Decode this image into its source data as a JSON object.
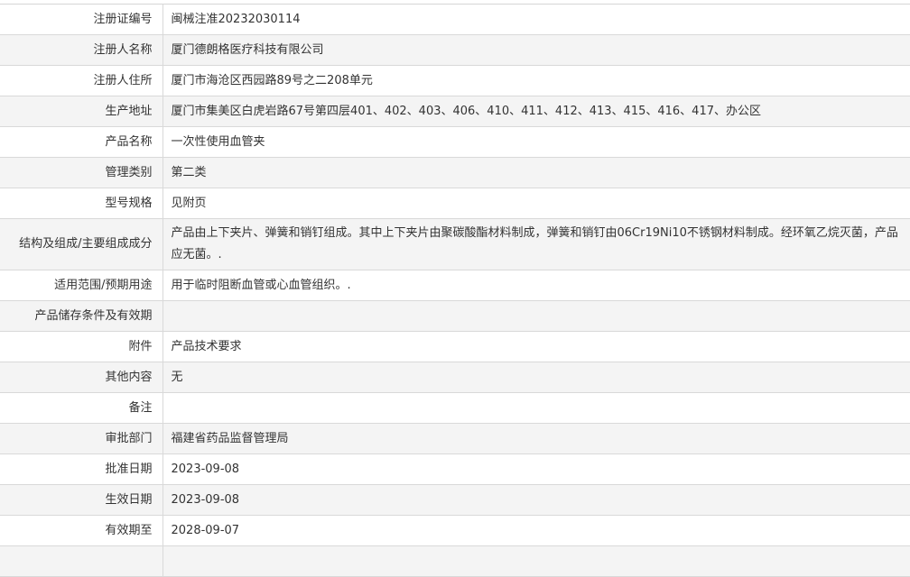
{
  "record": {
    "rows": [
      {
        "label": "注册证编号",
        "value": "闽械注准20232030114"
      },
      {
        "label": "注册人名称",
        "value": "厦门德朗格医疗科技有限公司"
      },
      {
        "label": "注册人住所",
        "value": "厦门市海沧区西园路89号之二208单元"
      },
      {
        "label": "生产地址",
        "value": "厦门市集美区白虎岩路67号第四层401、402、403、406、410、411、412、413、415、416、417、办公区"
      },
      {
        "label": "产品名称",
        "value": "一次性使用血管夹"
      },
      {
        "label": "管理类别",
        "value": "第二类"
      },
      {
        "label": "型号规格",
        "value": "见附页"
      },
      {
        "label": "结构及组成/主要组成成分",
        "value": "产品由上下夹片、弹簧和销钉组成。其中上下夹片由聚碳酸酯材料制成，弹簧和销钉由06Cr19Ni10不锈钢材料制成。经环氧乙烷灭菌，产品应无菌。."
      },
      {
        "label": "适用范围/预期用途",
        "value": "用于临时阻断血管或心血管组织。."
      },
      {
        "label": "产品储存条件及有效期",
        "value": ""
      },
      {
        "label": "附件",
        "value": "产品技术要求"
      },
      {
        "label": "其他内容",
        "value": "无"
      },
      {
        "label": "备注",
        "value": ""
      },
      {
        "label": "审批部门",
        "value": "福建省药品监督管理局"
      },
      {
        "label": "批准日期",
        "value": "2023-09-08"
      },
      {
        "label": "生效日期",
        "value": "2023-09-08"
      },
      {
        "label": "有效期至",
        "value": "2028-09-07"
      },
      {
        "label": "",
        "value": ""
      }
    ]
  }
}
